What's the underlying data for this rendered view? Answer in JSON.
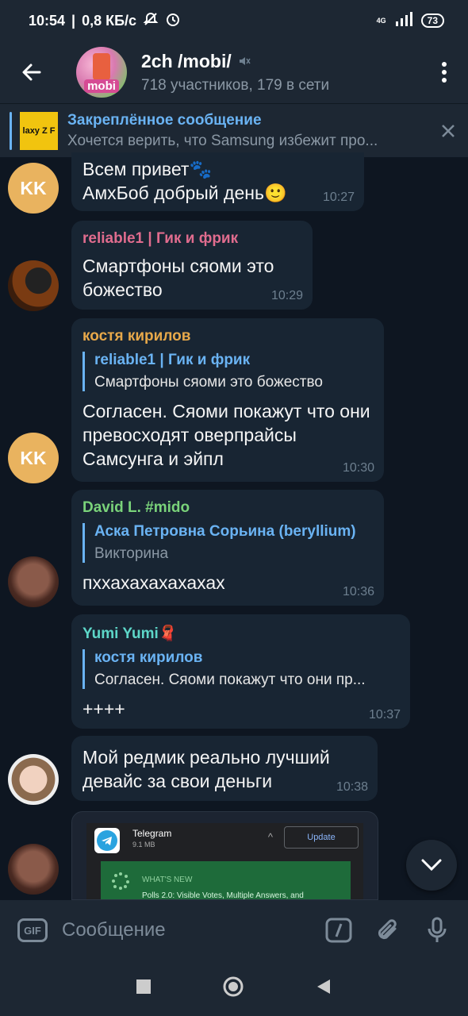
{
  "statusbar": {
    "time": "10:54",
    "speed": "0,8 КБ/с",
    "network": "4G",
    "battery": "73"
  },
  "header": {
    "title": "2ch /mobi/",
    "subtitle": "718 участников, 179 в сети",
    "avatar_label": "mobi"
  },
  "pinned": {
    "title": "Закреплённое сообщение",
    "text": "Хочется верить, что Samsung избежит про...",
    "thumb_text": "laxy Z F"
  },
  "messages": [
    {
      "avatar": "KK",
      "text": "Всем привет🐾\nАмхБоб добрый день🙂",
      "time": "10:27"
    },
    {
      "sender": "reliable1 | Гик и фрик",
      "sender_color": "#e06c8e",
      "text": "Смартфоны сяоми это божество",
      "time": "10:29"
    },
    {
      "avatar": "KK",
      "sender": "костя кирилов",
      "sender_color": "#e7a84a",
      "reply_name": "reliable1 | Гик и фрик",
      "reply_text": "Смартфоны сяоми это божество",
      "text": "Согласен. Сяоми покажут что они превосходят оверпрайсы Самсунга и эйпл",
      "time": "10:30"
    },
    {
      "sender": "David L. #mido",
      "sender_color": "#7ad37a",
      "reply_name": "Аска Петровна Сорьина (beryllium)",
      "reply_text": "Викторина",
      "text": "пххахахахахахах",
      "time": "10:36"
    },
    {
      "sender": "Yumi Yumi🧣",
      "sender_color": "#5dd6c8",
      "reply_name": "костя кирилов",
      "reply_text": "Согласен. Сяоми покажут что они пр...",
      "text": "++++",
      "time": "10:37"
    },
    {
      "text": "Мой редмик реально лучший девайс за свои деньги",
      "time": "10:38"
    }
  ],
  "preview": {
    "app_name": "Telegram",
    "app_size": "9.1 MB",
    "update_label": "Update",
    "whats_new": "WHAT'S NEW",
    "whats_new_line": "Polls 2.0: Visible Votes, Multiple Answers, and"
  },
  "composer": {
    "gif_label": "GIF",
    "placeholder": "Сообщение"
  },
  "colors": {
    "background": "#0e1621",
    "bar": "#1d2733",
    "bubble": "#182533",
    "accent": "#6ab3f3"
  }
}
